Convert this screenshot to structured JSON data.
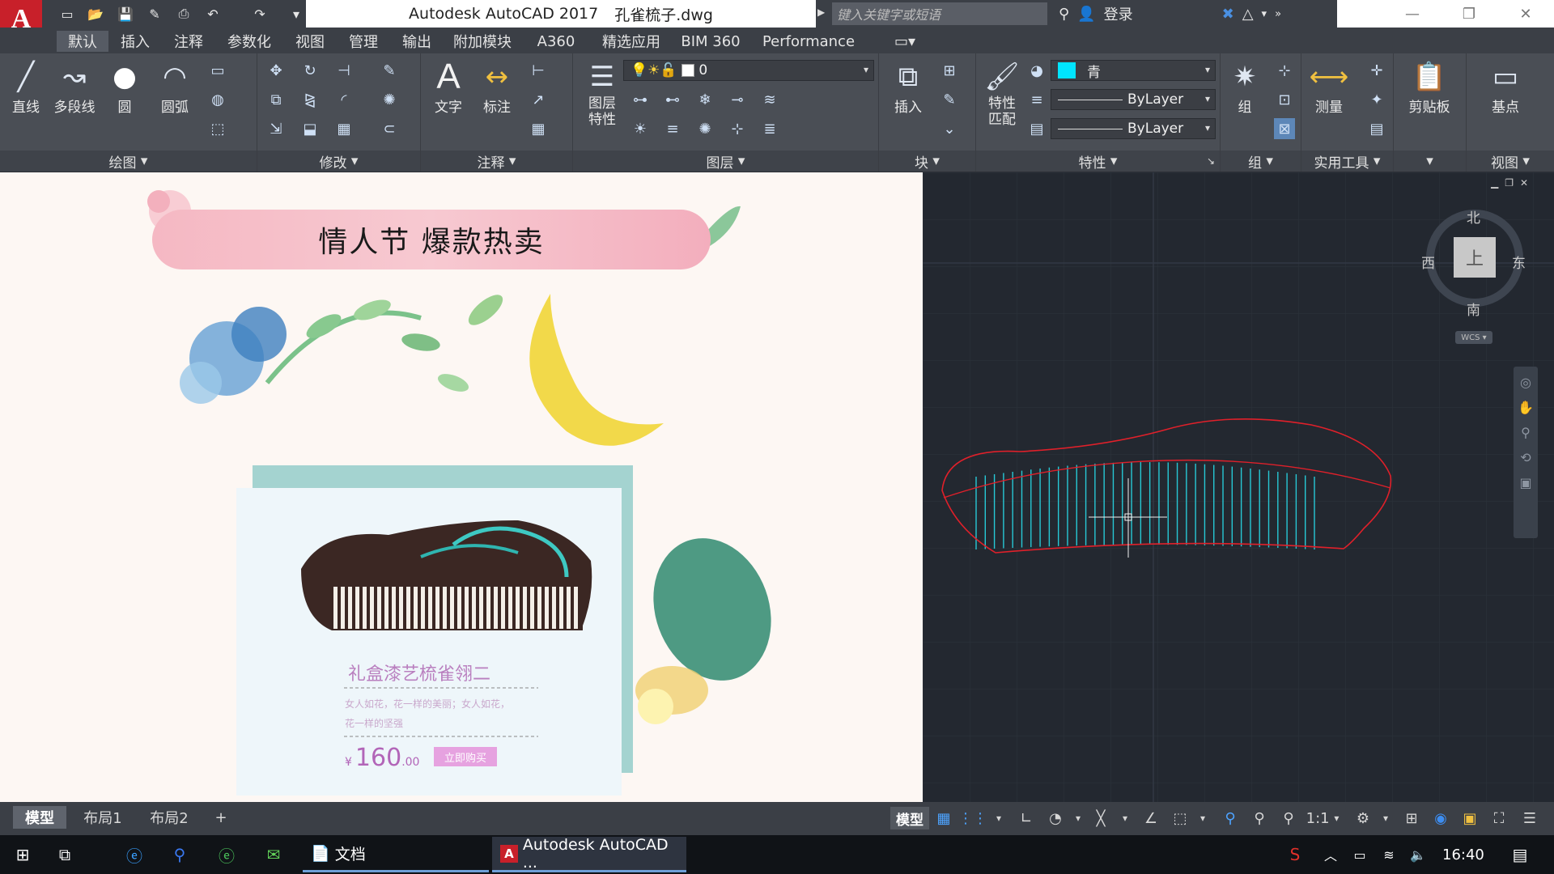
{
  "titlebar": {
    "app_title": "Autodesk AutoCAD 2017",
    "file_name": "孔雀梳子.dwg",
    "search_placeholder": "键入关键字或短语",
    "login_label": "登录",
    "logo_letter": "A"
  },
  "tabs": [
    "默认",
    "插入",
    "注释",
    "参数化",
    "视图",
    "管理",
    "输出",
    "附加模块",
    "A360",
    "精选应用",
    "BIM 360",
    "Performance"
  ],
  "ribbon": {
    "draw": {
      "title": "绘图",
      "line": "直线",
      "polyline": "多段线",
      "circle": "圆",
      "arc": "圆弧"
    },
    "modify": {
      "title": "修改"
    },
    "annotation": {
      "title": "注释",
      "text": "文字",
      "dimension": "标注",
      "text_glyph": "A"
    },
    "layers": {
      "title": "图层",
      "layer_props": "图层\n特性",
      "layer_value": "0"
    },
    "block": {
      "title": "块",
      "insert": "插入"
    },
    "properties": {
      "title": "特性",
      "match": "特性\n匹配",
      "color": "青",
      "linetype": "ByLayer",
      "lineweight": "ByLayer",
      "color_hex": "#00e5ff"
    },
    "groups": {
      "title": "组",
      "group": "组"
    },
    "utilities": {
      "title": "实用工具",
      "measure": "测量"
    },
    "clipboard": {
      "title": "",
      "paste": "剪贴板"
    },
    "view": {
      "title": "视图",
      "basepoint": "基点"
    }
  },
  "image": {
    "banner_text": "情人节  爆款热卖",
    "product_name": "礼盒漆艺梳雀翎二",
    "desc_line1": "女人如花，花一样的美丽；女人如花，",
    "desc_line2": "花一样的坚强",
    "price_symbol": "¥",
    "price_main": "160",
    "price_cents": ".00",
    "buy_button": "立即购买"
  },
  "cad": {
    "compass_n": "北",
    "compass_s": "南",
    "compass_e": "东",
    "compass_w": "西",
    "compass_center": "上",
    "wcs": "WCS",
    "outline_color": "#e0202a",
    "teeth_color": "#27c9d6"
  },
  "layout_tabs": [
    "模型",
    "布局1",
    "布局2",
    "+"
  ],
  "status": {
    "model": "模型",
    "scale": "1:1"
  },
  "taskbar": {
    "docs": "文档",
    "autocad": "Autodesk AutoCAD ...",
    "time": "16:40"
  }
}
